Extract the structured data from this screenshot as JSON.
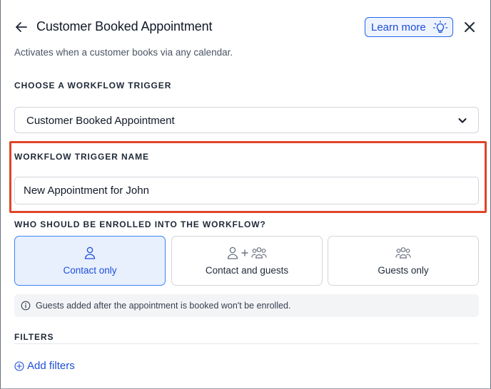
{
  "header": {
    "title": "Customer Booked Appointment",
    "learn_more_label": "Learn more",
    "back_icon": "arrow-left-icon",
    "close_icon": "close-icon"
  },
  "subtitle": "Activates when a customer books via any calendar.",
  "trigger": {
    "section_label": "CHOOSE A WORKFLOW TRIGGER",
    "selected_value": "Customer Booked Appointment"
  },
  "trigger_name": {
    "section_label": "WORKFLOW TRIGGER NAME",
    "value": "New Appointment for John"
  },
  "enrollment": {
    "section_label": "WHO SHOULD BE ENROLLED INTO THE WORKFLOW?",
    "options": [
      {
        "label": "Contact only",
        "icon": "person-icon",
        "selected": true
      },
      {
        "label": "Contact and guests",
        "icon": "person-plus-group-icon",
        "selected": false
      },
      {
        "label": "Guests only",
        "icon": "group-icon",
        "selected": false
      }
    ],
    "info_text": "Guests added after the appointment is booked won't be enrolled."
  },
  "filters": {
    "section_label": "FILTERS",
    "add_label": "Add filters"
  },
  "colors": {
    "accent": "#1d4ed8",
    "highlight": "#e0452b",
    "selected_bg": "#e8f0fe"
  }
}
